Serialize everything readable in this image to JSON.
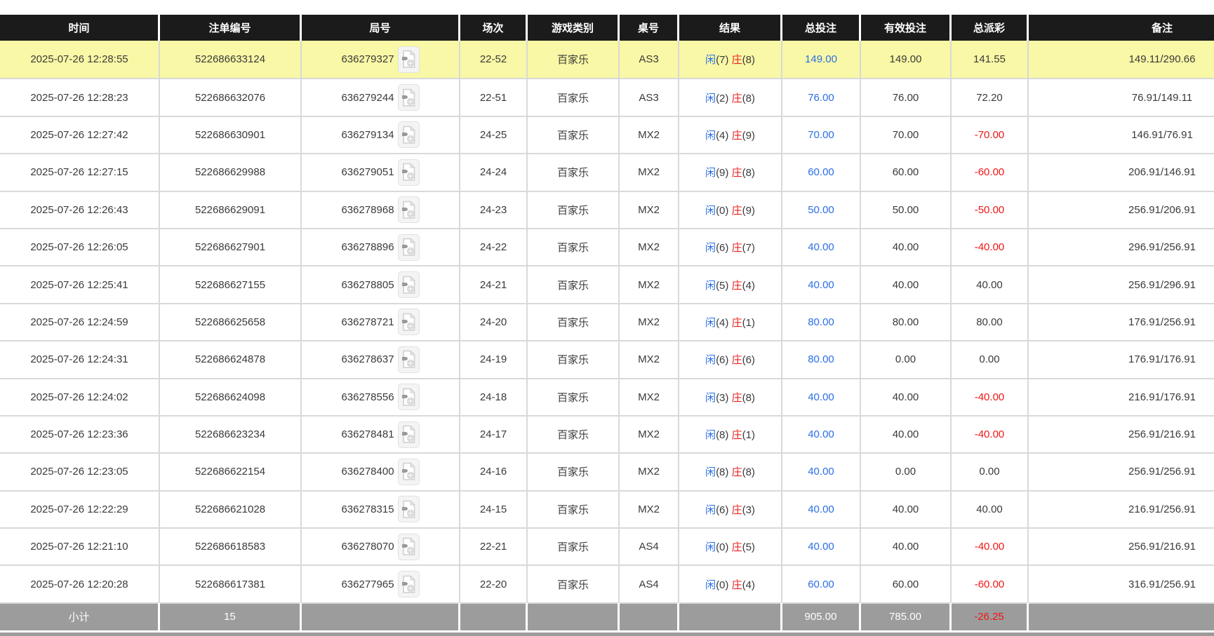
{
  "colors": {
    "header_bg": "#1b1b1b",
    "footer_bg": "#9c9c9c",
    "divider": "#d9d9d9",
    "highlight_yellow": "#f8f8a6",
    "player_blue": "#2b6fe3",
    "banker_red": "#e82222",
    "negative_red": "#f01515",
    "text_dark": "#3a3a3a"
  },
  "table": {
    "columns": [
      "时间",
      "注单编号",
      "局号",
      "场次",
      "游戏类别",
      "桌号",
      "结果",
      "总投注",
      "有效投注",
      "总派彩",
      "备注"
    ],
    "rows": [
      {
        "time": "2025-07-26 12:28:55",
        "bet_no": "522686633124",
        "round_no": "636279327",
        "session": "22-52",
        "game": "百家乐",
        "table_no": "AS3",
        "result": {
          "player_label": "闲",
          "player_score": "(7)",
          "banker_label": "庄",
          "banker_score": "(8)"
        },
        "total_bet": "149.00",
        "valid_bet": "149.00",
        "payout": "141.55",
        "remark": "149.11/290.66",
        "highlighted": true
      },
      {
        "time": "2025-07-26 12:28:23",
        "bet_no": "522686632076",
        "round_no": "636279244",
        "session": "22-51",
        "game": "百家乐",
        "table_no": "AS3",
        "result": {
          "player_label": "闲",
          "player_score": "(2)",
          "banker_label": "庄",
          "banker_score": "(8)"
        },
        "total_bet": "76.00",
        "valid_bet": "76.00",
        "payout": "72.20",
        "remark": "76.91/149.11",
        "highlighted": false
      },
      {
        "time": "2025-07-26 12:27:42",
        "bet_no": "522686630901",
        "round_no": "636279134",
        "session": "24-25",
        "game": "百家乐",
        "table_no": "MX2",
        "result": {
          "player_label": "闲",
          "player_score": "(4)",
          "banker_label": "庄",
          "banker_score": "(9)"
        },
        "total_bet": "70.00",
        "valid_bet": "70.00",
        "payout": "-70.00",
        "remark": "146.91/76.91",
        "highlighted": false
      },
      {
        "time": "2025-07-26 12:27:15",
        "bet_no": "522686629988",
        "round_no": "636279051",
        "session": "24-24",
        "game": "百家乐",
        "table_no": "MX2",
        "result": {
          "player_label": "闲",
          "player_score": "(9)",
          "banker_label": "庄",
          "banker_score": "(8)"
        },
        "total_bet": "60.00",
        "valid_bet": "60.00",
        "payout": "-60.00",
        "remark": "206.91/146.91",
        "highlighted": false
      },
      {
        "time": "2025-07-26 12:26:43",
        "bet_no": "522686629091",
        "round_no": "636278968",
        "session": "24-23",
        "game": "百家乐",
        "table_no": "MX2",
        "result": {
          "player_label": "闲",
          "player_score": "(0)",
          "banker_label": "庄",
          "banker_score": "(9)"
        },
        "total_bet": "50.00",
        "valid_bet": "50.00",
        "payout": "-50.00",
        "remark": "256.91/206.91",
        "highlighted": false
      },
      {
        "time": "2025-07-26 12:26:05",
        "bet_no": "522686627901",
        "round_no": "636278896",
        "session": "24-22",
        "game": "百家乐",
        "table_no": "MX2",
        "result": {
          "player_label": "闲",
          "player_score": "(6)",
          "banker_label": "庄",
          "banker_score": "(7)"
        },
        "total_bet": "40.00",
        "valid_bet": "40.00",
        "payout": "-40.00",
        "remark": "296.91/256.91",
        "highlighted": false
      },
      {
        "time": "2025-07-26 12:25:41",
        "bet_no": "522686627155",
        "round_no": "636278805",
        "session": "24-21",
        "game": "百家乐",
        "table_no": "MX2",
        "result": {
          "player_label": "闲",
          "player_score": "(5)",
          "banker_label": "庄",
          "banker_score": "(4)"
        },
        "total_bet": "40.00",
        "valid_bet": "40.00",
        "payout": "40.00",
        "remark": "256.91/296.91",
        "highlighted": false
      },
      {
        "time": "2025-07-26 12:24:59",
        "bet_no": "522686625658",
        "round_no": "636278721",
        "session": "24-20",
        "game": "百家乐",
        "table_no": "MX2",
        "result": {
          "player_label": "闲",
          "player_score": "(4)",
          "banker_label": "庄",
          "banker_score": "(1)"
        },
        "total_bet": "80.00",
        "valid_bet": "80.00",
        "payout": "80.00",
        "remark": "176.91/256.91",
        "highlighted": false
      },
      {
        "time": "2025-07-26 12:24:31",
        "bet_no": "522686624878",
        "round_no": "636278637",
        "session": "24-19",
        "game": "百家乐",
        "table_no": "MX2",
        "result": {
          "player_label": "闲",
          "player_score": "(6)",
          "banker_label": "庄",
          "banker_score": "(6)"
        },
        "total_bet": "80.00",
        "valid_bet": "0.00",
        "payout": "0.00",
        "remark": "176.91/176.91",
        "highlighted": false
      },
      {
        "time": "2025-07-26 12:24:02",
        "bet_no": "522686624098",
        "round_no": "636278556",
        "session": "24-18",
        "game": "百家乐",
        "table_no": "MX2",
        "result": {
          "player_label": "闲",
          "player_score": "(3)",
          "banker_label": "庄",
          "banker_score": "(8)"
        },
        "total_bet": "40.00",
        "valid_bet": "40.00",
        "payout": "-40.00",
        "remark": "216.91/176.91",
        "highlighted": false
      },
      {
        "time": "2025-07-26 12:23:36",
        "bet_no": "522686623234",
        "round_no": "636278481",
        "session": "24-17",
        "game": "百家乐",
        "table_no": "MX2",
        "result": {
          "player_label": "闲",
          "player_score": "(8)",
          "banker_label": "庄",
          "banker_score": "(1)"
        },
        "total_bet": "40.00",
        "valid_bet": "40.00",
        "payout": "-40.00",
        "remark": "256.91/216.91",
        "highlighted": false
      },
      {
        "time": "2025-07-26 12:23:05",
        "bet_no": "522686622154",
        "round_no": "636278400",
        "session": "24-16",
        "game": "百家乐",
        "table_no": "MX2",
        "result": {
          "player_label": "闲",
          "player_score": "(8)",
          "banker_label": "庄",
          "banker_score": "(8)"
        },
        "total_bet": "40.00",
        "valid_bet": "0.00",
        "payout": "0.00",
        "remark": "256.91/256.91",
        "highlighted": false
      },
      {
        "time": "2025-07-26 12:22:29",
        "bet_no": "522686621028",
        "round_no": "636278315",
        "session": "24-15",
        "game": "百家乐",
        "table_no": "MX2",
        "result": {
          "player_label": "闲",
          "player_score": "(6)",
          "banker_label": "庄",
          "banker_score": "(3)"
        },
        "total_bet": "40.00",
        "valid_bet": "40.00",
        "payout": "40.00",
        "remark": "216.91/256.91",
        "highlighted": false
      },
      {
        "time": "2025-07-26 12:21:10",
        "bet_no": "522686618583",
        "round_no": "636278070",
        "session": "22-21",
        "game": "百家乐",
        "table_no": "AS4",
        "result": {
          "player_label": "闲",
          "player_score": "(0)",
          "banker_label": "庄",
          "banker_score": "(5)"
        },
        "total_bet": "40.00",
        "valid_bet": "40.00",
        "payout": "-40.00",
        "remark": "256.91/216.91",
        "highlighted": false
      },
      {
        "time": "2025-07-26 12:20:28",
        "bet_no": "522686617381",
        "round_no": "636277965",
        "session": "22-20",
        "game": "百家乐",
        "table_no": "AS4",
        "result": {
          "player_label": "闲",
          "player_score": "(0)",
          "banker_label": "庄",
          "banker_score": "(4)"
        },
        "total_bet": "60.00",
        "valid_bet": "60.00",
        "payout": "-60.00",
        "remark": "316.91/256.91",
        "highlighted": false
      }
    ],
    "footer": {
      "label": "小计",
      "count": "15",
      "total_bet": "905.00",
      "valid_bet": "785.00",
      "payout": "-26.25"
    }
  }
}
